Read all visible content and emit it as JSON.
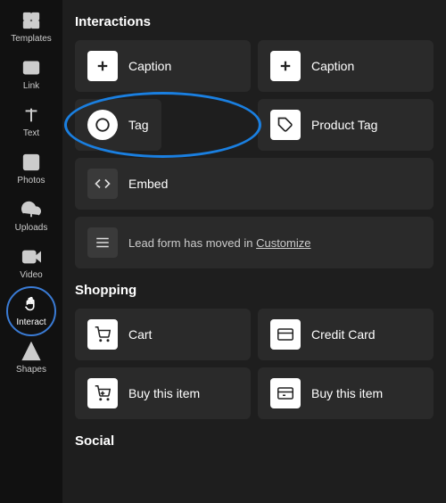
{
  "sidebar": {
    "items": [
      {
        "id": "templates",
        "label": "Templates",
        "active": false
      },
      {
        "id": "link",
        "label": "Link",
        "active": false
      },
      {
        "id": "text",
        "label": "Text",
        "active": false
      },
      {
        "id": "photos",
        "label": "Photos",
        "active": false
      },
      {
        "id": "uploads",
        "label": "Uploads",
        "active": false
      },
      {
        "id": "video",
        "label": "Video",
        "active": false
      },
      {
        "id": "interact",
        "label": "Interact",
        "active": true
      },
      {
        "id": "shapes",
        "label": "Shapes",
        "active": false
      }
    ]
  },
  "main": {
    "interactions_title": "Interactions",
    "buttons": {
      "caption1": "Caption",
      "caption2": "Caption",
      "tag": "Tag",
      "product_tag": "Product Tag",
      "embed": "Embed",
      "lead_form_text": "Lead form has moved in ",
      "lead_form_link": "Customize"
    },
    "shopping_title": "Shopping",
    "shopping_buttons": {
      "cart": "Cart",
      "credit_card": "Credit Card",
      "buy1": "Buy this item",
      "buy2": "Buy this item"
    },
    "social_title": "Social"
  }
}
